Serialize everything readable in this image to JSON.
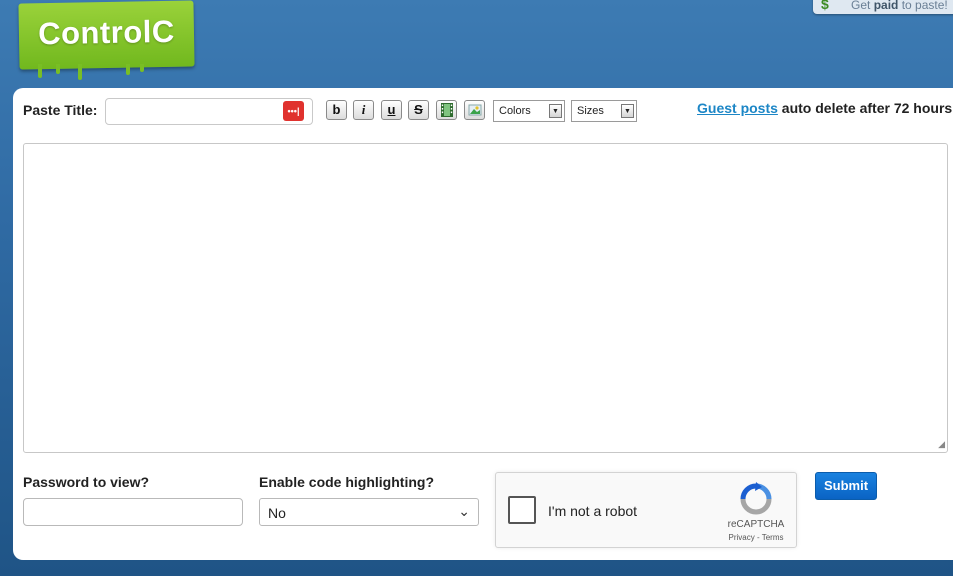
{
  "header": {
    "logo_text": "ControlC",
    "promo_prefix": "Get ",
    "promo_bold": "paid",
    "promo_suffix": " to paste!",
    "promo_icon": "dollar-icon"
  },
  "toolbar": {
    "paste_title_label": "Paste Title:",
    "title_value": "",
    "password_icon": "password-manager-icon",
    "bold_label": "b",
    "italic_label": "i",
    "underline_label": "u",
    "strike_label": "S",
    "video_icon": "film-icon",
    "image_icon": "image-icon",
    "colors_label": "Colors",
    "sizes_label": "Sizes"
  },
  "notice": {
    "link_text": "Guest posts",
    "text": " auto delete after 72 hours"
  },
  "paste": {
    "content": ""
  },
  "form": {
    "password_label": "Password to view?",
    "password_value": "",
    "highlight_label": "Enable code highlighting?",
    "highlight_value": "No",
    "captcha_label": "I'm not a robot",
    "captcha_brand": "reCAPTCHA",
    "captcha_privacy": "Privacy",
    "captcha_sep": " - ",
    "captcha_terms": "Terms",
    "submit_label": "Submit"
  },
  "colors": {
    "accent": "#1c86c6",
    "logo_green": "#8cc63f",
    "submit_blue": "#0a6fd1",
    "password_icon_red": "#e0322e"
  }
}
